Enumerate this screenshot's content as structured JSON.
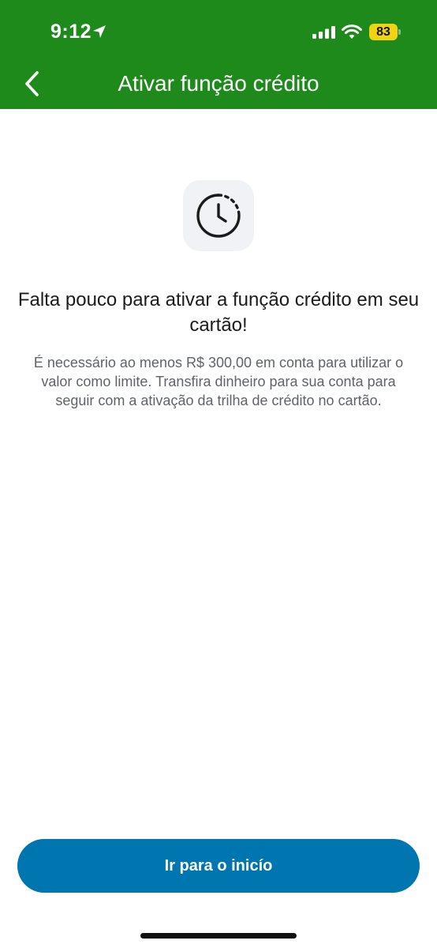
{
  "status_bar": {
    "time": "9:12",
    "battery": "83",
    "icons": [
      "location-arrow-icon",
      "cellular-signal-icon",
      "wifi-icon",
      "battery-icon"
    ]
  },
  "header": {
    "title": "Ativar função crédito",
    "back_icon": "chevron-left-icon",
    "background": "#1f8a1c"
  },
  "content": {
    "icon": "clock-pending-icon",
    "headline": "Falta pouco para ativar a função crédito em seu cartão!",
    "description": "É necessário ao menos R$ 300,00 em conta para utilizar o valor como limite. Transfira dinheiro para sua conta para seguir com a ativação da trilha de crédito no cartão."
  },
  "footer": {
    "button_label": "Ir para o inicío",
    "button_color": "#0076b0"
  }
}
